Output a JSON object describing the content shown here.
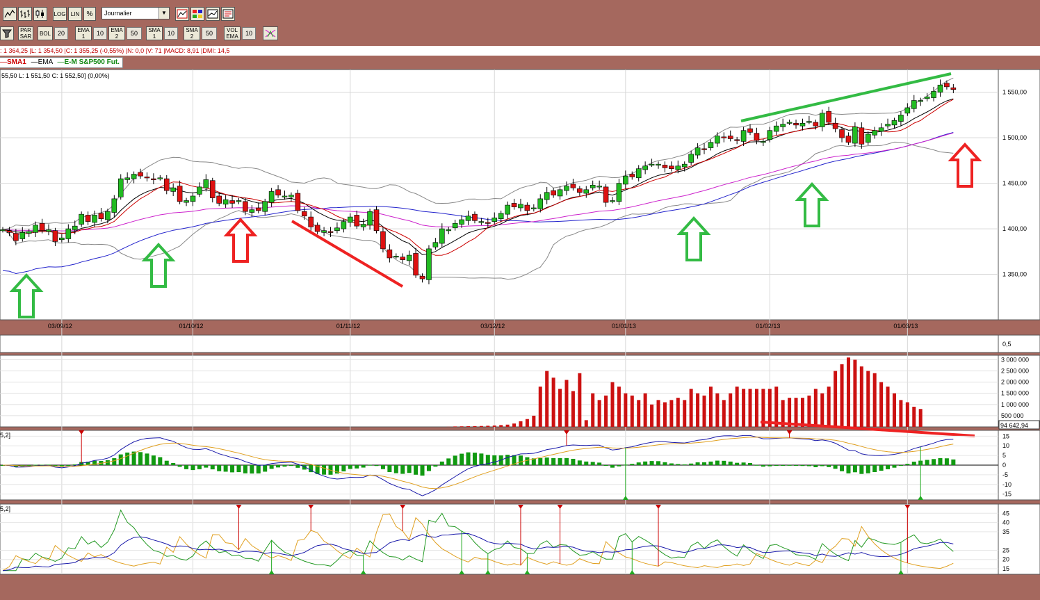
{
  "toolbar1": {
    "buttons": [
      {
        "id": "line",
        "label": ""
      },
      {
        "id": "bar",
        "label": ""
      },
      {
        "id": "candle",
        "label": ""
      },
      {
        "id": "log",
        "label": "LOG"
      },
      {
        "id": "lin",
        "label": "LIN"
      },
      {
        "id": "pct",
        "label": "%"
      }
    ],
    "period": "Journalier"
  },
  "toolbar2": {
    "items": [
      {
        "label": "PAR\nSAR"
      },
      {
        "label": "BOL",
        "value": "20"
      },
      {
        "label": "EMA\n1",
        "value": "10"
      },
      {
        "label": "EMA\n2",
        "value": "50"
      },
      {
        "label": "SMA\n1",
        "value": "10"
      },
      {
        "label": "SMA\n2",
        "value": "50"
      },
      {
        "label": "VOL\nEMA",
        "value": "10"
      }
    ]
  },
  "info_line": ": 1 364,25 |L: 1 354,50 |C: 1 355,25 (-0,55%) |N: 0,0 |V: 71 |MACD: 8,91 |DMI: 14,5",
  "legend": {
    "sma1": "SMA1",
    "ema": "EMA",
    "series": "E-M S&P500 Fut."
  },
  "price_info": "55,50   L: 1 551,50   C: 1 552,50] (0,00%)",
  "colors": {
    "frame": "#a5685e",
    "up": "#22bb22",
    "down": "#dd1111",
    "sma50": "#2222cc",
    "ema50": "#cc22cc",
    "bands": "#888888",
    "macd": "#1a1aaa",
    "signal": "#e0a020",
    "volume": "#cc1111",
    "dmi_plus": "#229922",
    "dmi_minus": "#e0a020",
    "adx": "#1a1aaa",
    "annot_green": "#33bb44",
    "annot_red": "#ee2222"
  },
  "chart_data": [
    {
      "type": "candlestick",
      "title": "E-M S&P500 Fut.",
      "x_ticks": [
        "03/09/12",
        "01/10/12",
        "01/11/12",
        "03/12/12",
        "01/01/13",
        "01/02/13",
        "01/03/13"
      ],
      "y_ticks": [
        "1 350,00",
        "1 400,00",
        "1 450,00",
        "1 500,00",
        "1 550,00"
      ],
      "ylim": [
        1300,
        1575
      ],
      "closes": [
        1399,
        1396,
        1387,
        1396,
        1397,
        1404,
        1398,
        1399,
        1386,
        1390,
        1400,
        1403,
        1416,
        1408,
        1415,
        1411,
        1419,
        1433,
        1455,
        1456,
        1460,
        1458,
        1456,
        1454,
        1456,
        1442,
        1445,
        1430,
        1431,
        1436,
        1446,
        1454,
        1434,
        1428,
        1432,
        1428,
        1431,
        1419,
        1421,
        1420,
        1430,
        1441,
        1437,
        1436,
        1437,
        1420,
        1414,
        1402,
        1397,
        1398,
        1396,
        1401,
        1408,
        1413,
        1403,
        1405,
        1419,
        1398,
        1378,
        1368,
        1370,
        1366,
        1371,
        1349,
        1345,
        1378,
        1385,
        1400,
        1399,
        1406,
        1410,
        1414,
        1409,
        1408,
        1406,
        1412,
        1417,
        1426,
        1424,
        1427,
        1420,
        1423,
        1433,
        1440,
        1437,
        1443,
        1447,
        1445,
        1440,
        1443,
        1448,
        1447,
        1429,
        1431,
        1450,
        1458,
        1457,
        1466,
        1469,
        1471,
        1471,
        1467,
        1466,
        1469,
        1471,
        1482,
        1489,
        1487,
        1495,
        1502,
        1500,
        1499,
        1497,
        1508,
        1506,
        1497,
        1496,
        1508,
        1513,
        1515,
        1517,
        1514,
        1516,
        1518,
        1513,
        1527,
        1517,
        1510,
        1500,
        1495,
        1512,
        1493,
        1504,
        1508,
        1511,
        1515,
        1519,
        1525,
        1533,
        1541,
        1541,
        1545,
        1551,
        1558,
        1556,
        1553
      ],
      "annotations": [
        {
          "kind": "up-arrow",
          "color": "annot_green"
        },
        {
          "kind": "up-arrow",
          "color": "annot_green"
        },
        {
          "kind": "up-arrow",
          "color": "annot_red"
        },
        {
          "kind": "down-trendline",
          "color": "annot_red"
        },
        {
          "kind": "up-arrow",
          "color": "annot_green"
        },
        {
          "kind": "up-arrow",
          "color": "annot_green"
        },
        {
          "kind": "up-trendline",
          "color": "annot_green"
        },
        {
          "kind": "up-arrow",
          "color": "annot_red"
        }
      ]
    },
    {
      "type": "line",
      "name": "panel-small",
      "y_ticks": [
        "0,5"
      ]
    },
    {
      "type": "bar",
      "name": "volume",
      "y_ticks": [
        "3 000 000",
        "2 500 000",
        "2 000 000",
        "1 500 000",
        "1 000 000",
        "500 000"
      ],
      "last_value": "94 642,94",
      "ylim": [
        0,
        3200000
      ],
      "values": [
        0,
        0,
        0,
        0,
        0,
        0,
        0,
        0,
        0,
        0,
        0,
        0,
        0,
        0,
        0,
        0,
        0,
        0,
        0,
        0,
        0,
        0,
        0,
        0,
        0,
        0,
        0,
        0,
        0,
        0,
        0,
        0,
        0,
        0,
        0,
        0,
        0,
        0,
        0,
        0,
        0,
        0,
        0,
        0,
        0,
        0,
        0,
        0,
        0,
        0,
        0,
        0,
        0,
        0,
        0,
        0,
        0,
        0,
        0,
        0,
        0,
        0,
        0,
        0,
        0,
        0,
        0,
        0,
        5000,
        20000,
        25000,
        30000,
        35000,
        40000,
        50000,
        60000,
        80000,
        100000,
        150000,
        250000,
        350000,
        500000,
        1800000,
        2500000,
        2200000,
        1700000,
        2100000,
        1600000,
        2400000,
        300000,
        1500000,
        1200000,
        1400000,
        2000000,
        1800000,
        1500000,
        1400000,
        1200000,
        1500000,
        1000000,
        1200000,
        1100000,
        1200000,
        1300000,
        1200000,
        1700000,
        1500000,
        1400000,
        1800000,
        1500000,
        1200000,
        1500000,
        1800000,
        1700000,
        1700000,
        1700000,
        1700000,
        1700000,
        1800000,
        1200000,
        1300000,
        1300000,
        1300000,
        1400000,
        1700000,
        1500000,
        1800000,
        2500000,
        2800000,
        3100000,
        3000000,
        2700000,
        2500000,
        2400000,
        2000000,
        1800000,
        1500000,
        1200000,
        1100000,
        900000,
        800000
      ],
      "annotations": [
        {
          "kind": "down-trendline",
          "color": "annot_red"
        }
      ]
    },
    {
      "type": "line",
      "name": "macd",
      "label": "5,2]",
      "y_ticks": [
        "15",
        "10",
        "5",
        "0",
        "-5",
        "-10",
        "-15"
      ],
      "ylim": [
        -18,
        18
      ]
    },
    {
      "type": "line",
      "name": "dmi",
      "label": "5,2]",
      "y_ticks": [
        "45",
        "40",
        "35",
        "25",
        "20",
        "15"
      ],
      "ylim": [
        12,
        50
      ]
    }
  ]
}
